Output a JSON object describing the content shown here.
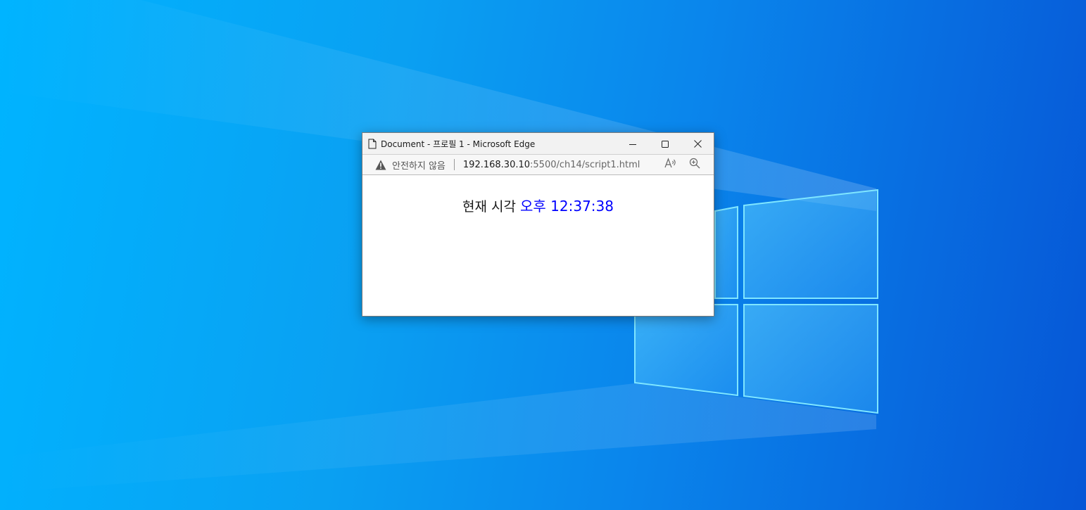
{
  "desktop": {
    "background_color": "#0a86ec"
  },
  "browser": {
    "window_title": "Document - 프로필 1 - Microsoft Edge",
    "address_bar": {
      "security_label": "안전하지 않음",
      "url_host": "192.168.30.10",
      "url_path": ":5500/ch14/script1.html"
    },
    "controls": {
      "minimize": "minimize-icon",
      "maximize": "maximize-icon",
      "close": "close-icon"
    }
  },
  "page": {
    "clock_label": "현재 시각",
    "clock_value": "오후 12:37:38",
    "clock_color": "#0000ff"
  }
}
